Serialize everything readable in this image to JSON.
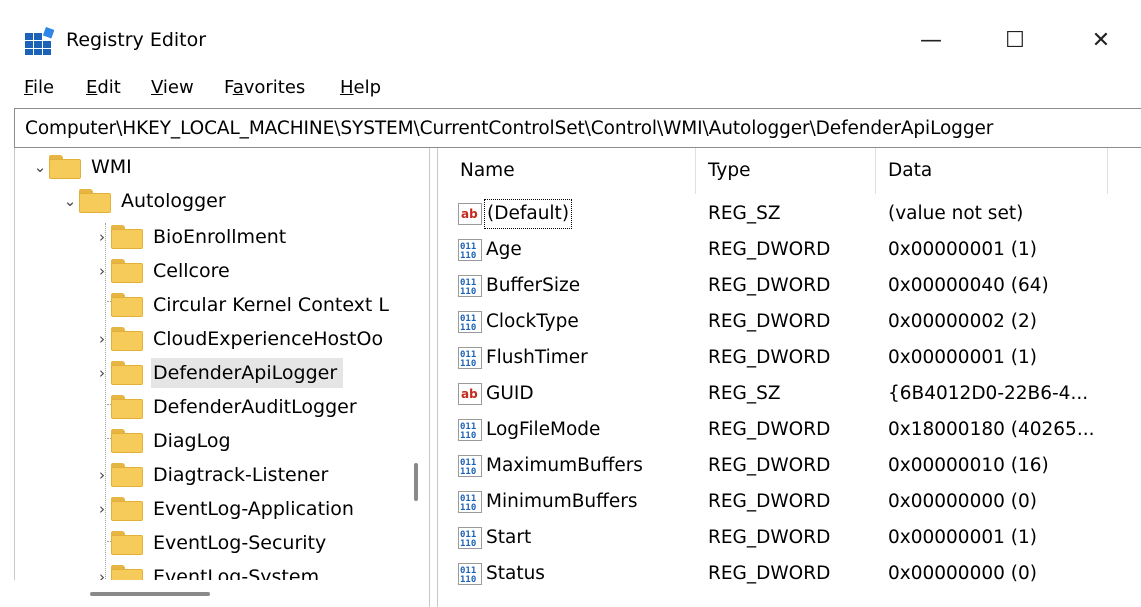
{
  "window": {
    "title": "Registry Editor",
    "controls": {
      "minimize": "—",
      "maximize": "☐",
      "close": "✕"
    }
  },
  "menu": {
    "items": [
      {
        "first": "F",
        "rest": "ile"
      },
      {
        "first": "E",
        "rest": "dit"
      },
      {
        "first": "V",
        "rest": "iew"
      },
      {
        "pre": "F",
        "first": "a",
        "rest": "vorites"
      },
      {
        "first": "H",
        "rest": "elp"
      }
    ]
  },
  "address": "Computer\\HKEY_LOCAL_MACHINE\\SYSTEM\\CurrentControlSet\\Control\\WMI\\Autologger\\DefenderApiLogger",
  "tree": {
    "items": [
      {
        "label": "WMI",
        "expander": "expanded"
      },
      {
        "label": "Autologger",
        "expander": "expanded"
      },
      {
        "label": "BioEnrollment",
        "expander": "collapsed"
      },
      {
        "label": "Cellcore",
        "expander": "collapsed"
      },
      {
        "label": "Circular Kernel Context L",
        "expander": "none"
      },
      {
        "label": "CloudExperienceHostOo",
        "expander": "collapsed"
      },
      {
        "label": "DefenderApiLogger",
        "expander": "collapsed",
        "selected": true
      },
      {
        "label": "DefenderAuditLogger",
        "expander": "none"
      },
      {
        "label": "DiagLog",
        "expander": "none"
      },
      {
        "label": "Diagtrack-Listener",
        "expander": "collapsed"
      },
      {
        "label": "EventLog-Application",
        "expander": "collapsed"
      },
      {
        "label": "EventLog-Security",
        "expander": "none"
      },
      {
        "label": "EventLog-System",
        "expander": "collapsed"
      }
    ]
  },
  "list": {
    "columns": {
      "name": "Name",
      "type": "Type",
      "data": "Data"
    },
    "rows": [
      {
        "name": "(Default)",
        "type": "REG_SZ",
        "data": "(value not set)",
        "icon": "string-value-icon"
      },
      {
        "name": "Age",
        "type": "REG_DWORD",
        "data": "0x00000001 (1)",
        "icon": "binary-value-icon"
      },
      {
        "name": "BufferSize",
        "type": "REG_DWORD",
        "data": "0x00000040 (64)",
        "icon": "binary-value-icon"
      },
      {
        "name": "ClockType",
        "type": "REG_DWORD",
        "data": "0x00000002 (2)",
        "icon": "binary-value-icon"
      },
      {
        "name": "FlushTimer",
        "type": "REG_DWORD",
        "data": "0x00000001 (1)",
        "icon": "binary-value-icon"
      },
      {
        "name": "GUID",
        "type": "REG_SZ",
        "data": "{6B4012D0-22B6-4...",
        "icon": "string-value-icon"
      },
      {
        "name": "LogFileMode",
        "type": "REG_DWORD",
        "data": "0x18000180 (40265...",
        "icon": "binary-value-icon"
      },
      {
        "name": "MaximumBuffers",
        "type": "REG_DWORD",
        "data": "0x00000010 (16)",
        "icon": "binary-value-icon"
      },
      {
        "name": "MinimumBuffers",
        "type": "REG_DWORD",
        "data": "0x00000000 (0)",
        "icon": "binary-value-icon"
      },
      {
        "name": "Start",
        "type": "REG_DWORD",
        "data": "0x00000001 (1)",
        "icon": "binary-value-icon"
      },
      {
        "name": "Status",
        "type": "REG_DWORD",
        "data": "0x00000000 (0)",
        "icon": "binary-value-icon"
      }
    ]
  },
  "colors": {
    "selection": "#e5e5e5",
    "folder": "#f6cb5a",
    "icon_blue": "#1c63b7",
    "icon_red": "#c42b1c"
  }
}
